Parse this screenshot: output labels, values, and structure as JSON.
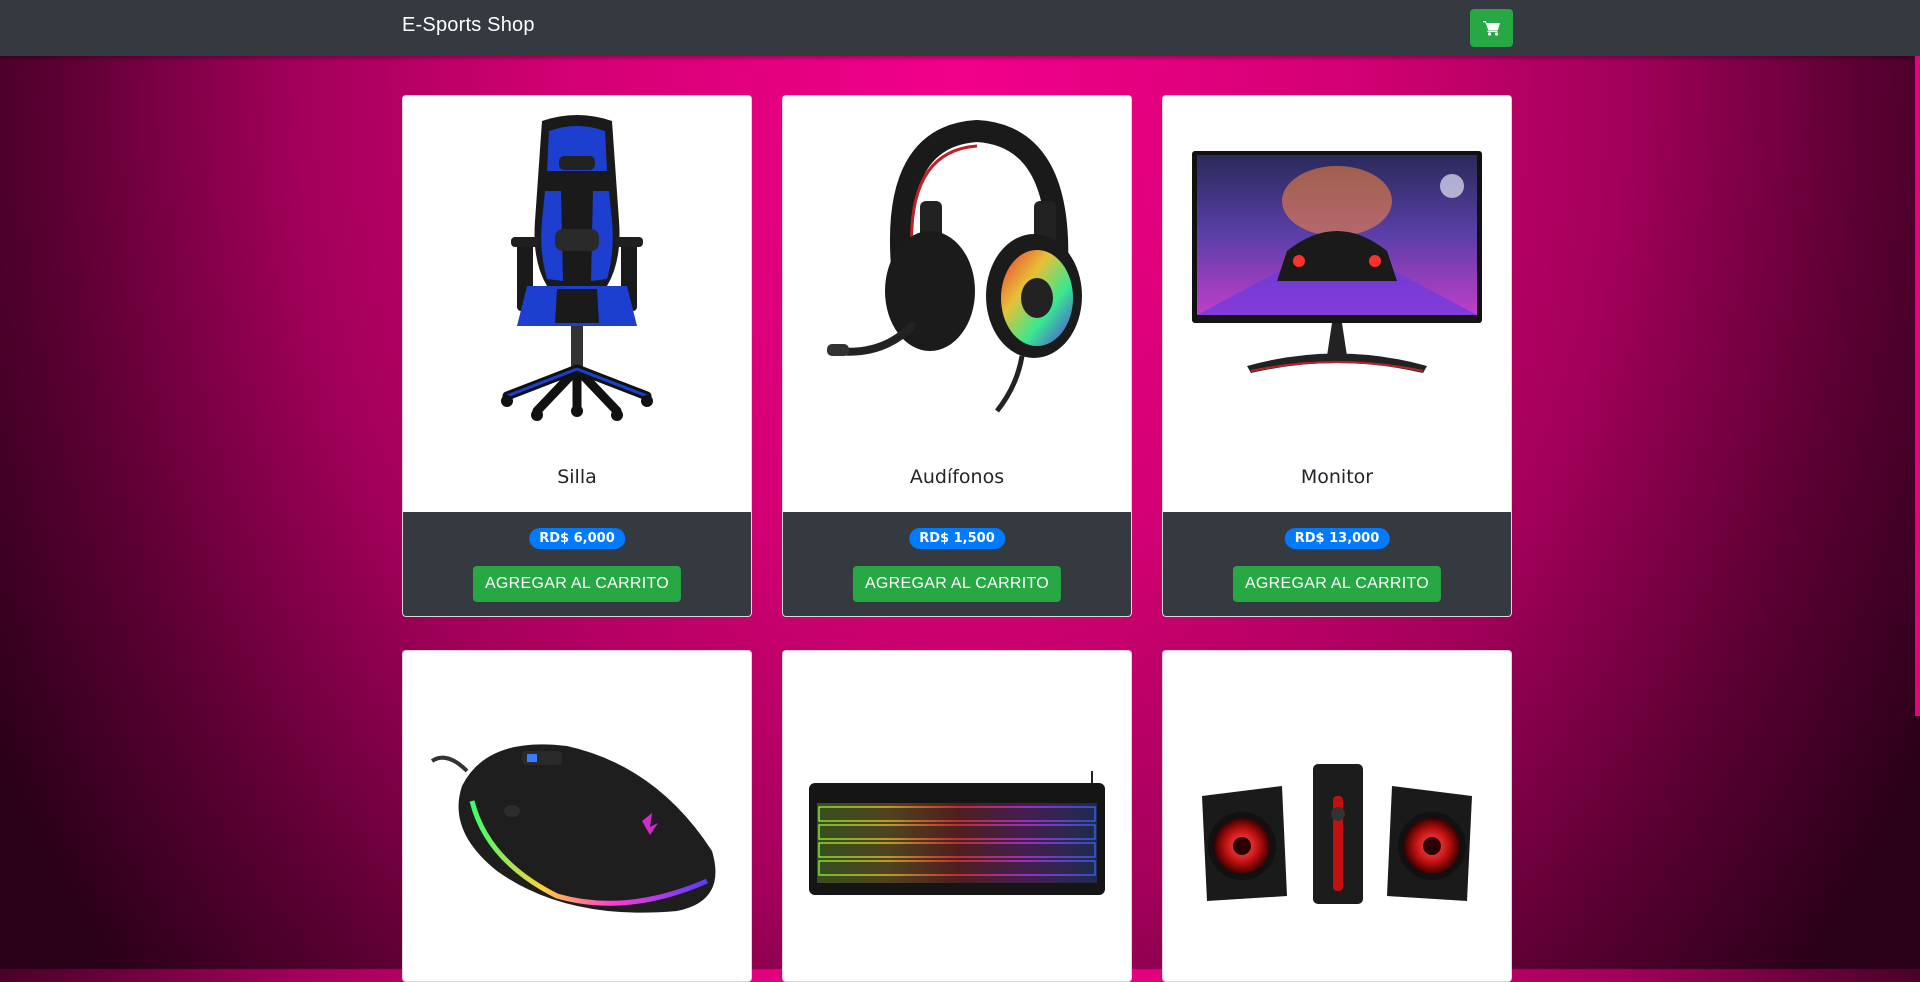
{
  "navbar": {
    "brand": "E-Sports Shop",
    "cart_icon": "cart-icon",
    "colors": {
      "background": "#343a40",
      "cart_button": "#28a745"
    }
  },
  "products": [
    {
      "name": "Silla",
      "price": "RD$ 6,000",
      "button": "AGREGAR AL CARRITO",
      "image": "gaming-chair-image"
    },
    {
      "name": "Audífonos",
      "price": "RD$ 1,500",
      "button": "AGREGAR AL CARRITO",
      "image": "headset-image"
    },
    {
      "name": "Monitor",
      "price": "RD$ 13,000",
      "button": "AGREGAR AL CARRITO",
      "image": "monitor-image"
    },
    {
      "name": "",
      "price": "",
      "button": "",
      "image": "gaming-mouse-image"
    },
    {
      "name": "",
      "price": "",
      "button": "",
      "image": "keyboard-image"
    },
    {
      "name": "",
      "price": "",
      "button": "",
      "image": "speakers-image"
    }
  ],
  "colors": {
    "accent": "#f2008a",
    "badge": "#007bff",
    "add_button": "#28a745",
    "card_footer": "#343a40"
  }
}
